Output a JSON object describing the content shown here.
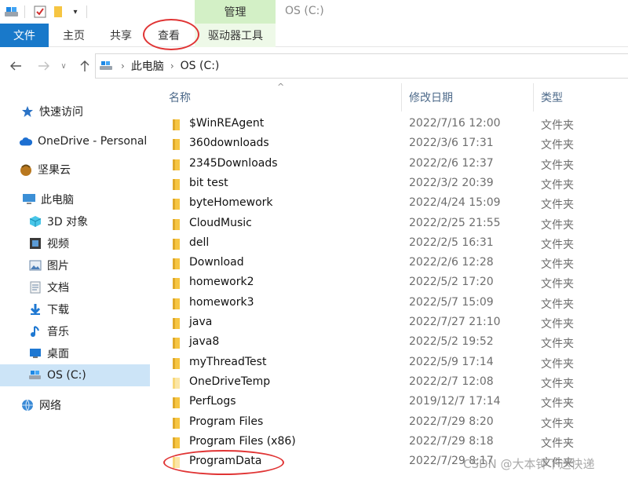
{
  "title_bar": {
    "manage_label": "管理",
    "window_title": "OS (C:)"
  },
  "ribbon": {
    "tabs": [
      {
        "label": "文件"
      },
      {
        "label": "主页"
      },
      {
        "label": "共享"
      },
      {
        "label": "查看"
      },
      {
        "label": "驱动器工具"
      }
    ],
    "file_tab_color": "#1979ca",
    "manage_color": "#d3f0c6"
  },
  "address": {
    "crumbs": [
      "此电脑",
      "OS (C:)"
    ]
  },
  "sidebar": {
    "items": [
      {
        "label": "快速访问",
        "icon": "star-icon"
      },
      {
        "label": "OneDrive - Personal",
        "icon": "cloud-icon"
      },
      {
        "label": "坚果云",
        "icon": "nut-icon"
      },
      {
        "label": "此电脑",
        "icon": "computer-icon"
      },
      {
        "label": "3D 对象",
        "icon": "cube-icon"
      },
      {
        "label": "视频",
        "icon": "film-icon"
      },
      {
        "label": "图片",
        "icon": "picture-icon"
      },
      {
        "label": "文档",
        "icon": "document-icon"
      },
      {
        "label": "下载",
        "icon": "download-icon"
      },
      {
        "label": "音乐",
        "icon": "music-icon"
      },
      {
        "label": "桌面",
        "icon": "desktop-icon"
      },
      {
        "label": "OS (C:)",
        "icon": "drive-icon"
      },
      {
        "label": "网络",
        "icon": "network-icon"
      }
    ],
    "selected_color": "#cce4f7"
  },
  "columns": {
    "name": "名称",
    "date": "修改日期",
    "type": "类型"
  },
  "files": [
    {
      "name": "$WinREAgent",
      "date": "2022/7/16 12:00",
      "type": "文件夹"
    },
    {
      "name": "360downloads",
      "date": "2022/3/6 17:31",
      "type": "文件夹"
    },
    {
      "name": "2345Downloads",
      "date": "2022/2/6 12:37",
      "type": "文件夹"
    },
    {
      "name": "bit test",
      "date": "2022/3/2 20:39",
      "type": "文件夹"
    },
    {
      "name": "byteHomework",
      "date": "2022/4/24 15:09",
      "type": "文件夹"
    },
    {
      "name": "CloudMusic",
      "date": "2022/2/25 21:55",
      "type": "文件夹"
    },
    {
      "name": "dell",
      "date": "2022/2/5 16:31",
      "type": "文件夹"
    },
    {
      "name": "Download",
      "date": "2022/2/6 12:28",
      "type": "文件夹"
    },
    {
      "name": "homework2",
      "date": "2022/5/2 17:20",
      "type": "文件夹"
    },
    {
      "name": "homework3",
      "date": "2022/5/7 15:09",
      "type": "文件夹"
    },
    {
      "name": "java",
      "date": "2022/7/27 21:10",
      "type": "文件夹"
    },
    {
      "name": "java8",
      "date": "2022/5/2 19:52",
      "type": "文件夹"
    },
    {
      "name": "myThreadTest",
      "date": "2022/5/9 17:14",
      "type": "文件夹"
    },
    {
      "name": "OneDriveTemp",
      "date": "2022/2/7 12:08",
      "type": "文件夹"
    },
    {
      "name": "PerfLogs",
      "date": "2019/12/7 17:14",
      "type": "文件夹"
    },
    {
      "name": "Program Files",
      "date": "2022/7/29 8:20",
      "type": "文件夹"
    },
    {
      "name": "Program Files (x86)",
      "date": "2022/7/29 8:18",
      "type": "文件夹"
    },
    {
      "name": "ProgramData",
      "date": "2022/7/29 8:17",
      "type": "文件夹"
    }
  ],
  "folder_color": "#f6c542",
  "annotation_color": "#e03434",
  "watermark": "CSDN @大本钟下送快递"
}
